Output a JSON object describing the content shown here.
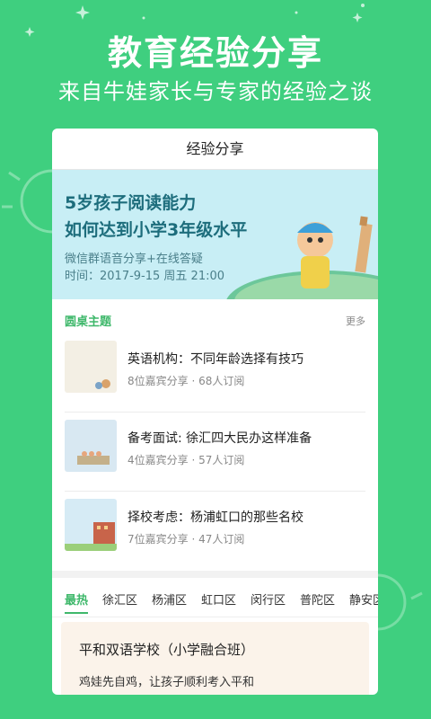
{
  "hero": {
    "title": "教育经验分享",
    "subtitle": "来自牛娃家长与专家的经验之谈"
  },
  "card": {
    "header": "经验分享",
    "banner": {
      "line1": "5岁孩子阅读能力",
      "line2": "如何达到小学3年级水平",
      "line3": "微信群语音分享+在线答疑",
      "line4": "时间：2017-9-15 周五 21:00"
    },
    "section": {
      "title": "圆桌主题",
      "more": "更多"
    },
    "topics": [
      {
        "title": "英语机构：不同年龄选择有技巧",
        "meta": "8位嘉宾分享 · 68人订阅"
      },
      {
        "title": "备考面试: 徐汇四大民办这样准备",
        "meta": "4位嘉宾分享 · 57人订阅"
      },
      {
        "title": "择校考虑：杨浦虹口的那些名校",
        "meta": "7位嘉宾分享 · 47人订阅"
      }
    ],
    "tabs": [
      "最热",
      "徐汇区",
      "杨浦区",
      "虹口区",
      "闵行区",
      "普陀区",
      "静安区"
    ],
    "school": {
      "title": "平和双语学校（小学融合班）",
      "desc": "鸡娃先自鸡，让孩子顺利考入平和"
    }
  },
  "colors": {
    "brand": "#3fcf7f",
    "accent": "#3fb86b",
    "banner_text": "#1d6d7c"
  }
}
